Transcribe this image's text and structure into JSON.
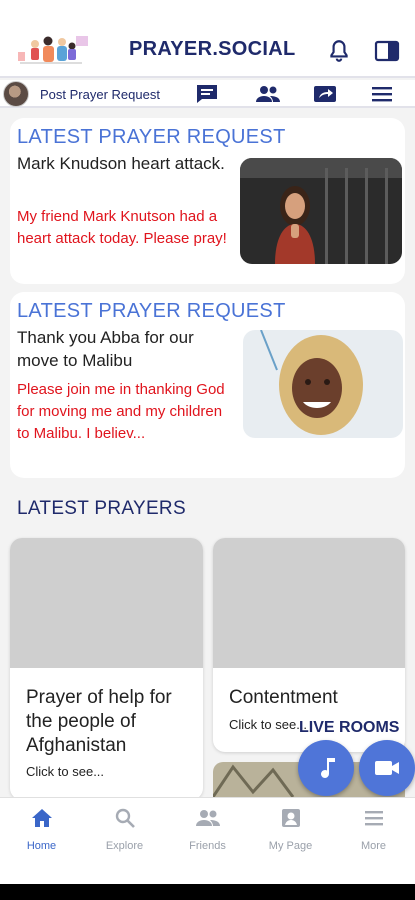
{
  "header": {
    "brand": "PRAYER.SOCIAL",
    "icons": [
      "people-illustration-logo",
      "bell-icon",
      "sidebar-panel-icon"
    ]
  },
  "subbar": {
    "post_label": "Post Prayer Request",
    "icons": [
      "chat-icon",
      "friends-icon",
      "share-icon",
      "menu-icon"
    ]
  },
  "requests": [
    {
      "heading": "LATEST PRAYER REQUEST",
      "title": "Mark Knudson heart attack.",
      "body": "My friend Mark Knutson had a heart attack today. Please pray!"
    },
    {
      "heading": "LATEST PRAYER REQUEST",
      "title": "Thank you Abba for our move to Malibu",
      "body": "Please join me in thanking God for moving me and my children to Malibu. I believ..."
    }
  ],
  "latest_prayers": {
    "title": "LATEST PRAYERS",
    "items": [
      {
        "title": "Prayer of help for the people of Afghanistan",
        "sub": "Click to see..."
      },
      {
        "title": "Contentment",
        "sub": "Click to see..."
      }
    ]
  },
  "live_rooms": {
    "label": "LIVE ROOMS"
  },
  "bottom_nav": [
    {
      "label": "Home",
      "icon": "home-icon",
      "active": true
    },
    {
      "label": "Explore",
      "icon": "search-icon",
      "active": false
    },
    {
      "label": "Friends",
      "icon": "friends-icon",
      "active": false
    },
    {
      "label": "My Page",
      "icon": "profile-icon",
      "active": false
    },
    {
      "label": "More",
      "icon": "menu-icon",
      "active": false
    }
  ],
  "colors": {
    "brand": "#1f2a6b",
    "accent": "#4a73d6",
    "request_body": "#e0141d",
    "fab": "#4f75d8"
  }
}
